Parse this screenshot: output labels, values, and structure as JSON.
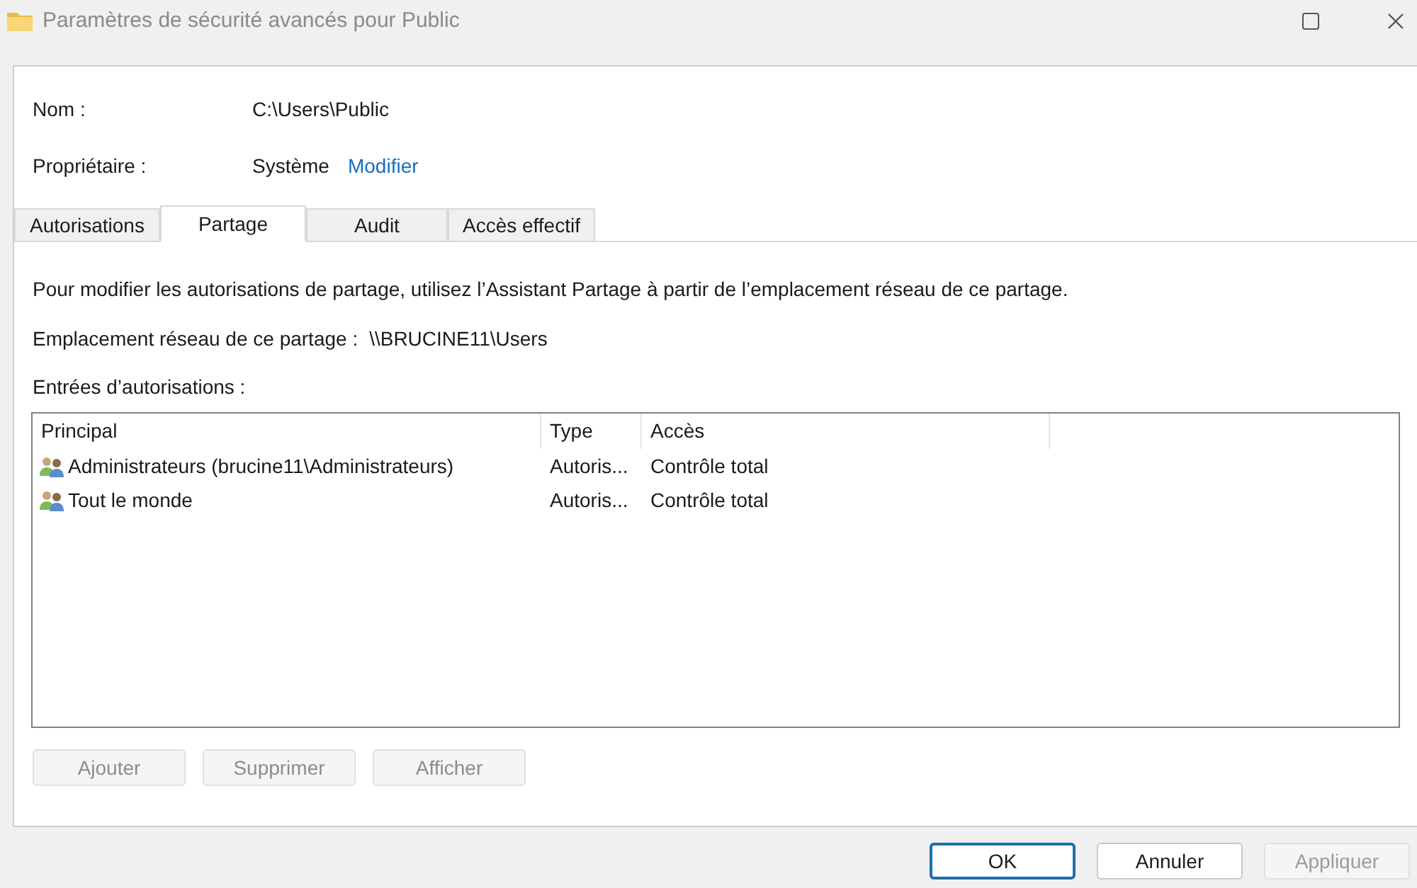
{
  "window": {
    "title": "Paramètres de sécurité avancés pour Public"
  },
  "fields": [
    {
      "label": "Nom :",
      "value": "C:\\Users\\Public"
    },
    {
      "label": "Propriétaire :",
      "value": "Système",
      "link": "Modifier"
    }
  ],
  "tabs": [
    {
      "label": "Autorisations",
      "selected": false
    },
    {
      "label": "Partage",
      "selected": true
    },
    {
      "label": "Audit",
      "selected": false
    },
    {
      "label": "Accès effectif",
      "selected": false
    }
  ],
  "description": "Pour modifier les autorisations de partage, utilisez l’Assistant Partage à partir de l’emplacement réseau de ce partage.",
  "network_location": {
    "label": "Emplacement réseau de ce partage :",
    "value": "\\\\BRUCINE11\\Users"
  },
  "entries_label": "Entrées d’autorisations :",
  "table": {
    "columns": [
      "Principal",
      "Type",
      "Accès"
    ],
    "rows": [
      {
        "principal": "Administrateurs (brucine11\\Administrateurs)",
        "type": "Autoris...",
        "access": "Contrôle total"
      },
      {
        "principal": "Tout le monde",
        "type": "Autoris...",
        "access": "Contrôle total"
      }
    ]
  },
  "entry_buttons": [
    {
      "label": "Ajouter",
      "disabled": true
    },
    {
      "label": "Supprimer",
      "disabled": true
    },
    {
      "label": "Afficher",
      "disabled": true
    }
  ],
  "dialog_buttons": [
    {
      "label": "OK",
      "disabled": false,
      "default": true
    },
    {
      "label": "Annuler",
      "disabled": false,
      "default": false
    },
    {
      "label": "Appliquer",
      "disabled": true,
      "default": false
    }
  ]
}
